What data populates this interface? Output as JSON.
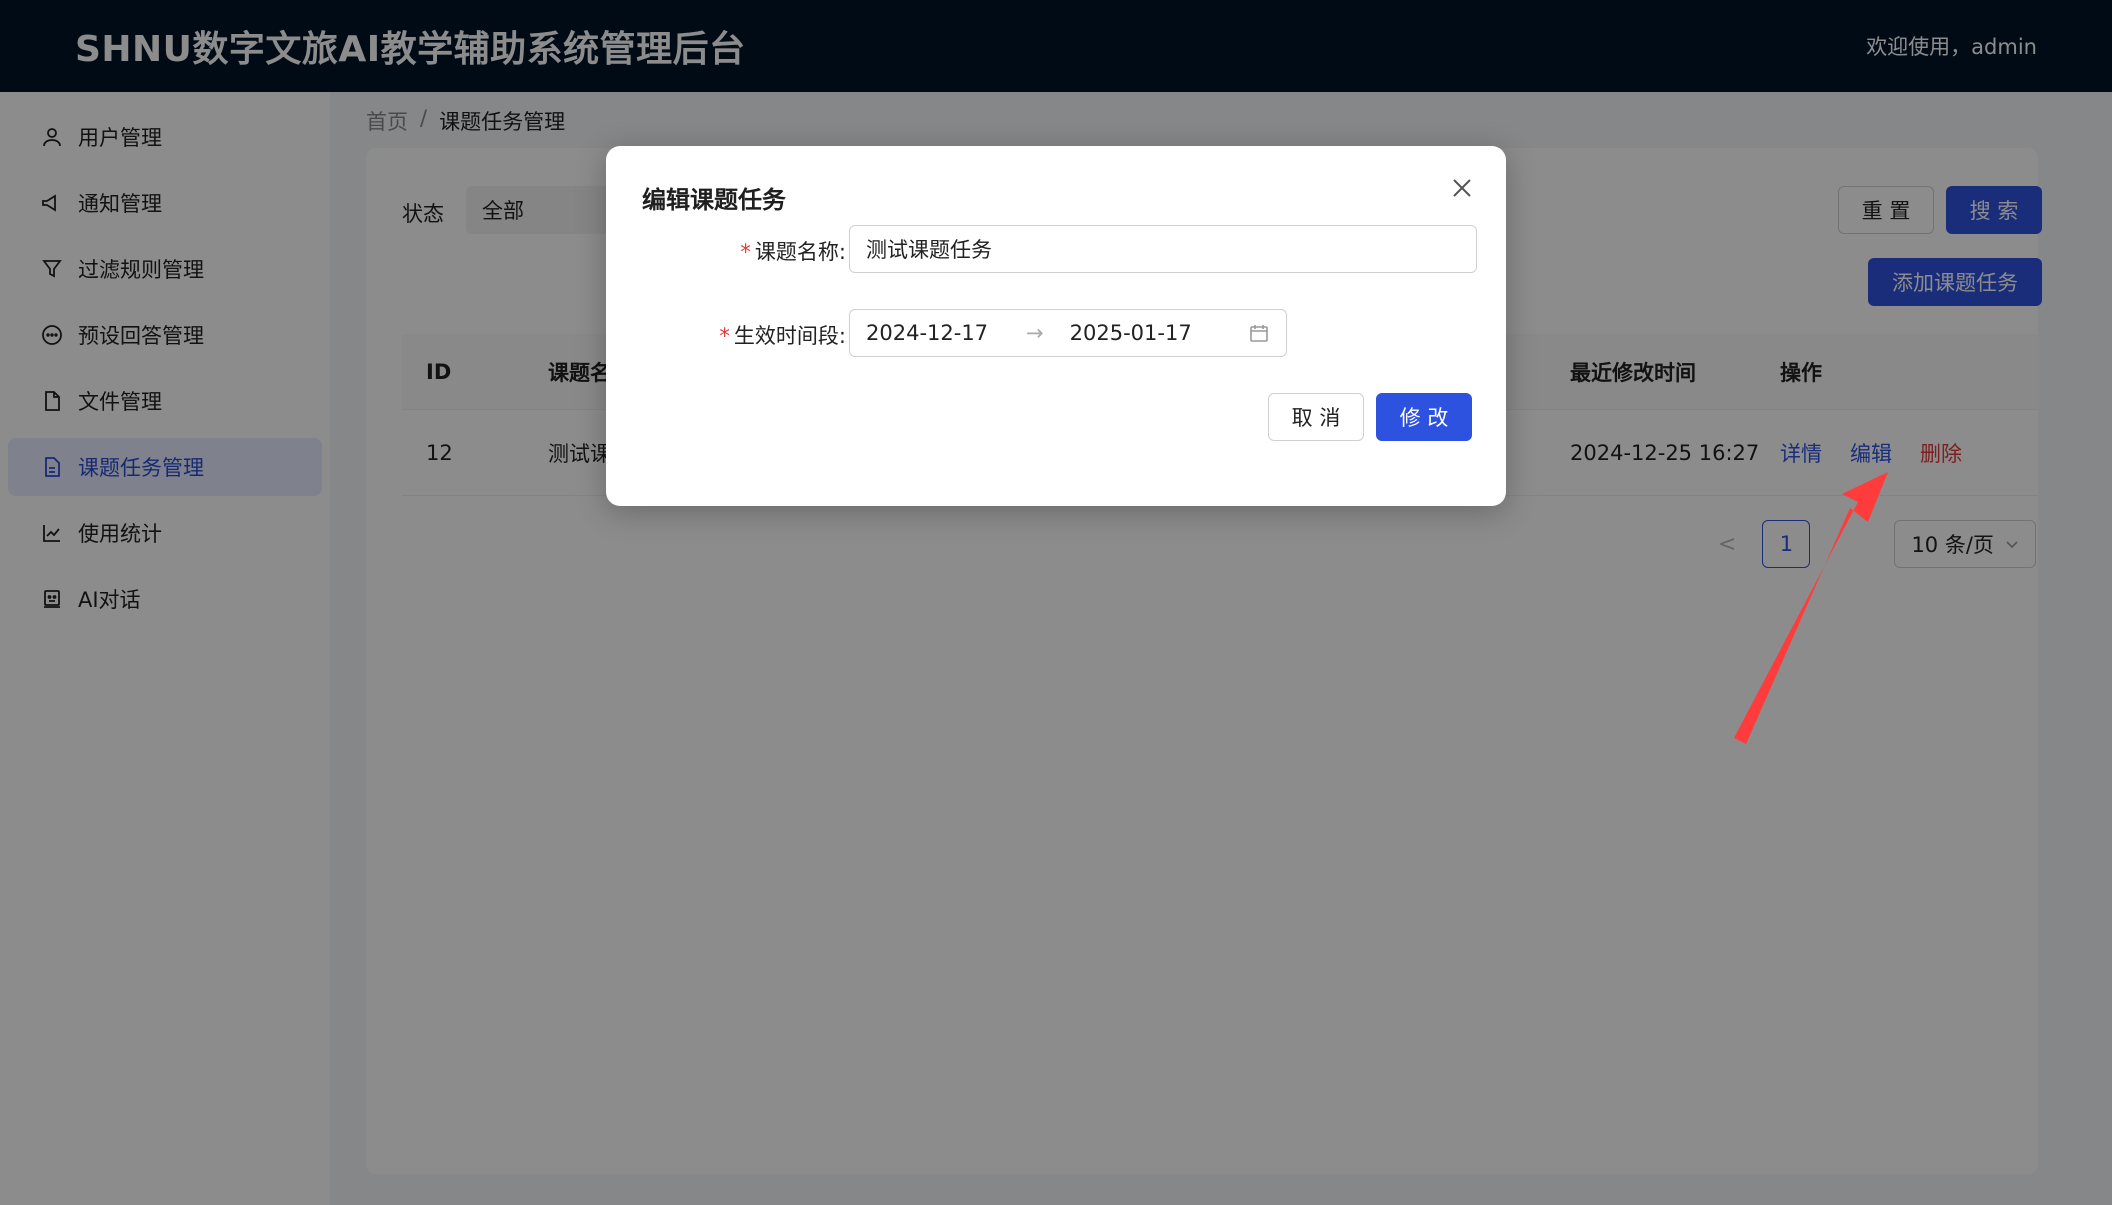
{
  "header": {
    "title": "SHNU数字文旅AI教学辅助系统管理后台",
    "welcome": "欢迎使用，admin"
  },
  "sidebar": {
    "items": [
      {
        "label": "用户管理",
        "icon": "user-icon"
      },
      {
        "label": "通知管理",
        "icon": "megaphone-icon"
      },
      {
        "label": "过滤规则管理",
        "icon": "filter-icon"
      },
      {
        "label": "预设回答管理",
        "icon": "chat-icon"
      },
      {
        "label": "文件管理",
        "icon": "file-icon"
      },
      {
        "label": "课题任务管理",
        "icon": "task-file-icon",
        "active": true
      },
      {
        "label": "使用统计",
        "icon": "line-chart-icon"
      },
      {
        "label": "AI对话",
        "icon": "robot-icon"
      }
    ]
  },
  "breadcrumb": {
    "home": "首页",
    "sep": "/",
    "current": "课题任务管理"
  },
  "filters": {
    "status_label": "状态",
    "status_value": "全部",
    "reset": "重 置",
    "search": "搜 索",
    "add": "添加课题任务"
  },
  "table": {
    "headers": {
      "id": "ID",
      "name": "课题名",
      "modified": "最近修改时间",
      "actions": "操作"
    },
    "rows": [
      {
        "id": "12",
        "name": "测试课",
        "modified": "2024-12-25 16:27",
        "detail": "详情",
        "edit": "编辑",
        "delete": "删除"
      }
    ]
  },
  "pagination": {
    "prev": "<",
    "page": "1",
    "page_size": "10 条/页"
  },
  "modal": {
    "title": "编辑课题任务",
    "name_label": "课题名称:",
    "name_value": "测试课题任务",
    "period_label": "生效时间段:",
    "start": "2024-12-17",
    "arrow": "→",
    "end": "2025-01-17",
    "cancel": "取 消",
    "ok": "修 改"
  },
  "colors": {
    "header_bg": "#001529",
    "primary": "#2e52e0",
    "danger": "#e03a3a",
    "annotation": "#ff3b3b"
  }
}
